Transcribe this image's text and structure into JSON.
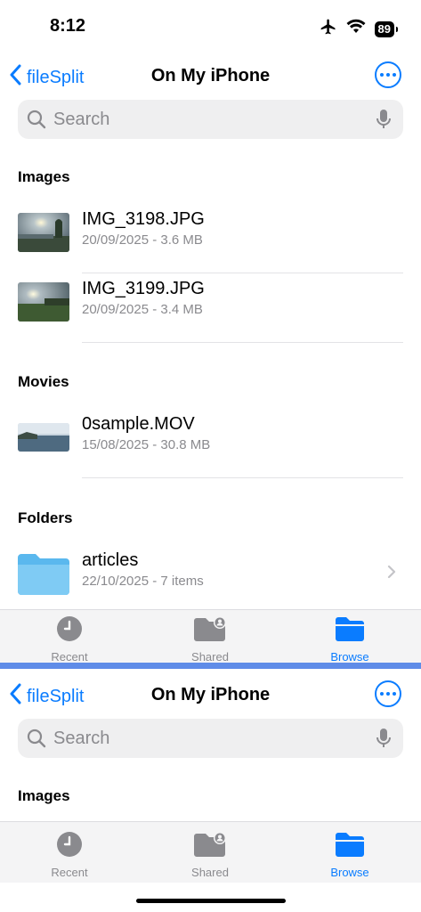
{
  "status": {
    "time": "8:12",
    "battery": "89"
  },
  "nav": {
    "back_label": "fileSplit",
    "title": "On My iPhone"
  },
  "search": {
    "placeholder": "Search"
  },
  "sections": {
    "images": "Images",
    "movies": "Movies",
    "folders": "Folders"
  },
  "files": {
    "img1": {
      "name": "IMG_3198.JPG",
      "meta": "20/09/2025 - 3.6 MB"
    },
    "img2": {
      "name": "IMG_3199.JPG",
      "meta": "20/09/2025 - 3.4 MB"
    },
    "mov1": {
      "name": "0sample.MOV",
      "meta": "15/08/2025 - 30.8 MB"
    },
    "folder1": {
      "name": "articles",
      "meta": "22/10/2025 - 7 items"
    }
  },
  "tabs": {
    "recent": "Recent",
    "shared": "Shared",
    "browse": "Browse"
  },
  "colors": {
    "accent": "#0a7cff",
    "divider": "#5f8ce8",
    "folder": "#5ab8ee"
  },
  "icons": [
    "airplane-icon",
    "wifi-icon",
    "battery-icon",
    "chevron-left-icon",
    "ellipsis-icon",
    "search-icon",
    "microphone-icon",
    "folder-icon",
    "chevron-right-icon",
    "clock-icon",
    "shared-folder-icon",
    "browse-folder-icon"
  ]
}
